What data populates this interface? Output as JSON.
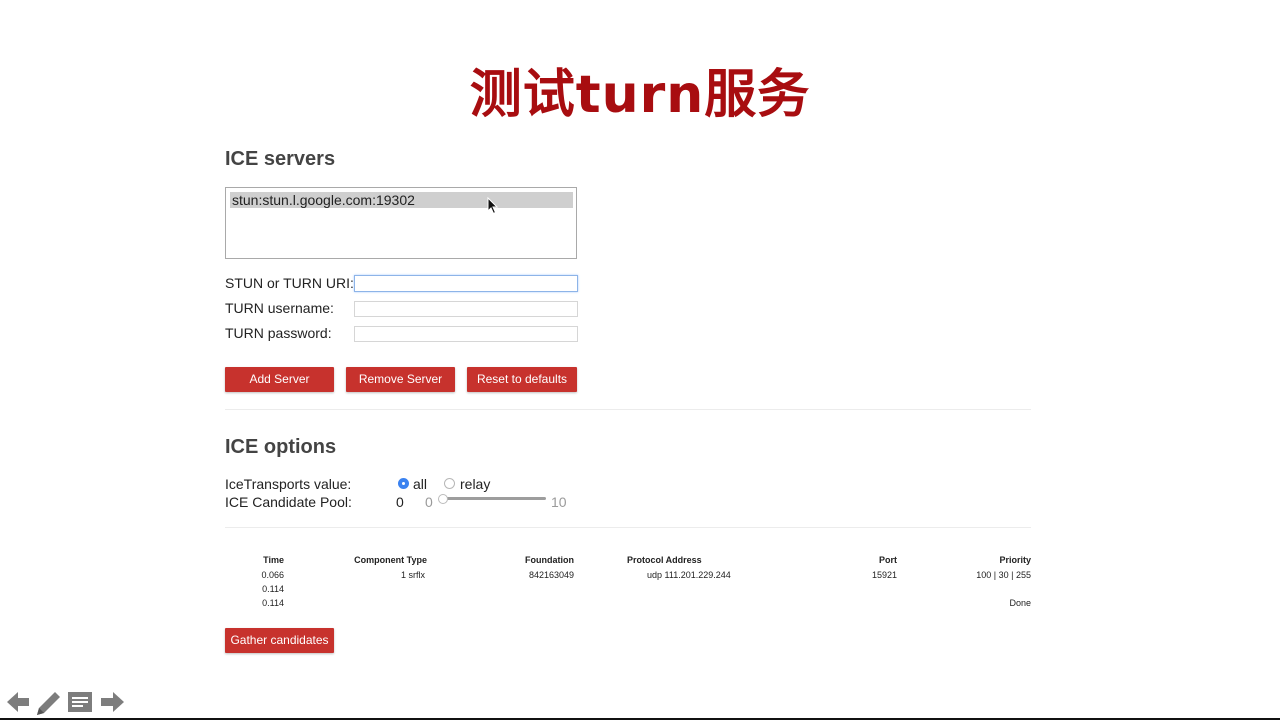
{
  "slide_title": "测试turn服务",
  "ice_servers": {
    "heading": "ICE servers",
    "servers": [
      "stun:stun.l.google.com:19302"
    ],
    "uri_label": "STUN or TURN URI:",
    "uri_value": "",
    "username_label": "TURN username:",
    "username_value": "",
    "password_label": "TURN password:",
    "password_value": "",
    "add_button": "Add Server",
    "remove_button": "Remove Server",
    "reset_button": "Reset to defaults"
  },
  "ice_options": {
    "heading": "ICE options",
    "transports_label": "IceTransports value:",
    "transport_all": "all",
    "transport_relay": "relay",
    "transport_selected": "all",
    "pool_label": "ICE Candidate Pool:",
    "pool_value": "0",
    "pool_min": "0",
    "pool_max": "10",
    "pool_level": 0
  },
  "candidates": {
    "headers": [
      "Time",
      "Component Type",
      "Foundation",
      "Protocol Address",
      "Port",
      "Priority"
    ],
    "rows": [
      [
        "0.066",
        "1 srflx",
        "842163049",
        "udp 111.201.229.244",
        "15921",
        "100 | 30 | 255"
      ],
      [
        "0.114",
        "",
        "",
        "",
        "",
        ""
      ],
      [
        "0.114",
        "",
        "",
        "",
        "",
        "Done"
      ]
    ]
  },
  "gather_button": "Gather candidates",
  "nav_icons": [
    "arrow-left-icon",
    "pencil-icon",
    "menu-icon",
    "arrow-right-icon"
  ],
  "colors": {
    "title": "#a80d10",
    "button": "#c7322d",
    "radio_checked": "#3b82f0"
  }
}
